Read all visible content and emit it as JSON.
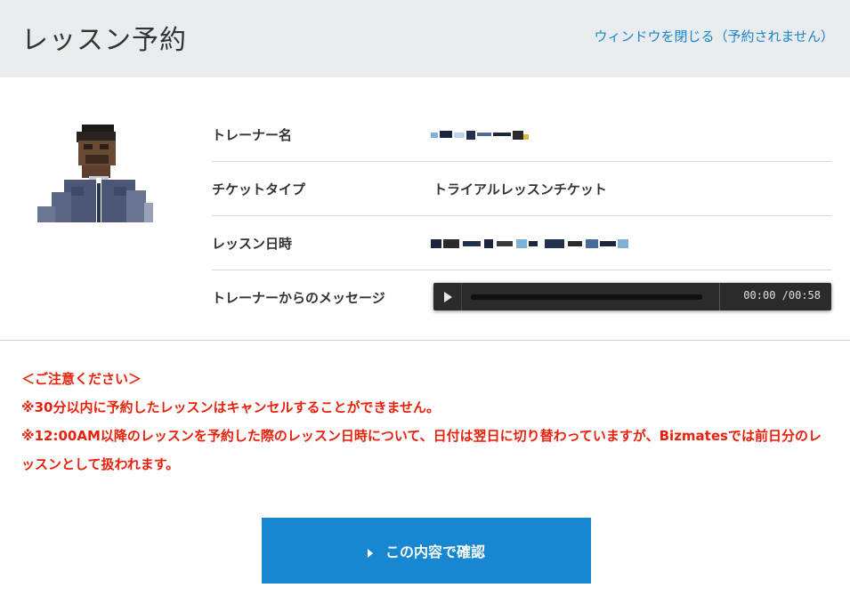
{
  "header": {
    "title": "レッスン予約",
    "close_link": "ウィンドウを閉じる（予約されません）"
  },
  "details": {
    "trainer_name_label": "トレーナー名",
    "ticket_type_label": "チケットタイプ",
    "ticket_type_value": "トライアルレッスンチケット",
    "lesson_datetime_label": "レッスン日時",
    "message_label": "トレーナーからのメッセージ"
  },
  "audio_player": {
    "current_time": "00:00",
    "duration": "00:58",
    "progress": 0
  },
  "notice": {
    "heading": "＜ご注意ください＞",
    "line1": "※30分以内に予約したレッスンはキャンセルすることができません。",
    "line2": "※12:00AM以降のレッスンを予約した際のレッスン日時について、日付は翌日に切り替わっていますが、Bizmatesでは前日分のレッスンとして扱われます。"
  },
  "confirm_button": {
    "label": "この内容で確認"
  },
  "colors": {
    "accent": "#1787d1",
    "link": "#1a84c7",
    "warning": "#e8210c",
    "header_bg": "#e9ecef"
  }
}
